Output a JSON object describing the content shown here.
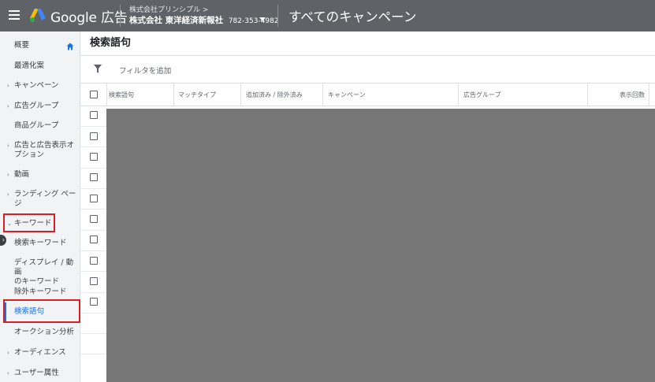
{
  "header": {
    "brand_google": "Google",
    "brand_ads": "広告",
    "account_parent": "株式会社プリンシプル  >",
    "account_name": "株式会社 東洋経済新報社",
    "account_id": "782-353-4982",
    "campaign_scope": "すべてのキャンペーン"
  },
  "sidebar": {
    "items": [
      {
        "label": "概要",
        "expandable": false
      },
      {
        "label": "最適化案",
        "expandable": false
      },
      {
        "label": "キャンペーン",
        "expandable": true
      },
      {
        "label": "広告グループ",
        "expandable": true
      },
      {
        "label": "商品グループ",
        "expandable": false
      },
      {
        "label": "広告と広告表示オ\nプション",
        "expandable": true
      },
      {
        "label": "動画",
        "expandable": true
      },
      {
        "label": "ランディング ペー\nジ",
        "expandable": true
      },
      {
        "label": "キーワード",
        "expandable": true,
        "expanded": true,
        "highlighted": true
      },
      {
        "label": "検索キーワード",
        "sub": true
      },
      {
        "label": "ディスプレイ / 動画\nのキーワード",
        "sub": true
      },
      {
        "label": "除外キーワード",
        "sub": true
      },
      {
        "label": "検索語句",
        "sub": true,
        "selected": true,
        "highlighted": true
      },
      {
        "label": "オークション分析",
        "sub": true
      },
      {
        "label": "オーディエンス",
        "expandable": true
      },
      {
        "label": "ユーザー属性",
        "expandable": true
      }
    ]
  },
  "main": {
    "title": "検索語句",
    "filter_label": "フィルタを追加",
    "columns": [
      "検索語句",
      "マッチタイプ",
      "追加済み / 除外済み",
      "キャンペーン",
      "広告グループ",
      "表示回数"
    ],
    "row_count": 10
  },
  "colors": {
    "topbar": "#5f6368",
    "sidebar": "#f1f3f4",
    "accent": "#1a73e8",
    "highlight": "#d61f26",
    "redacted": "#777777"
  }
}
